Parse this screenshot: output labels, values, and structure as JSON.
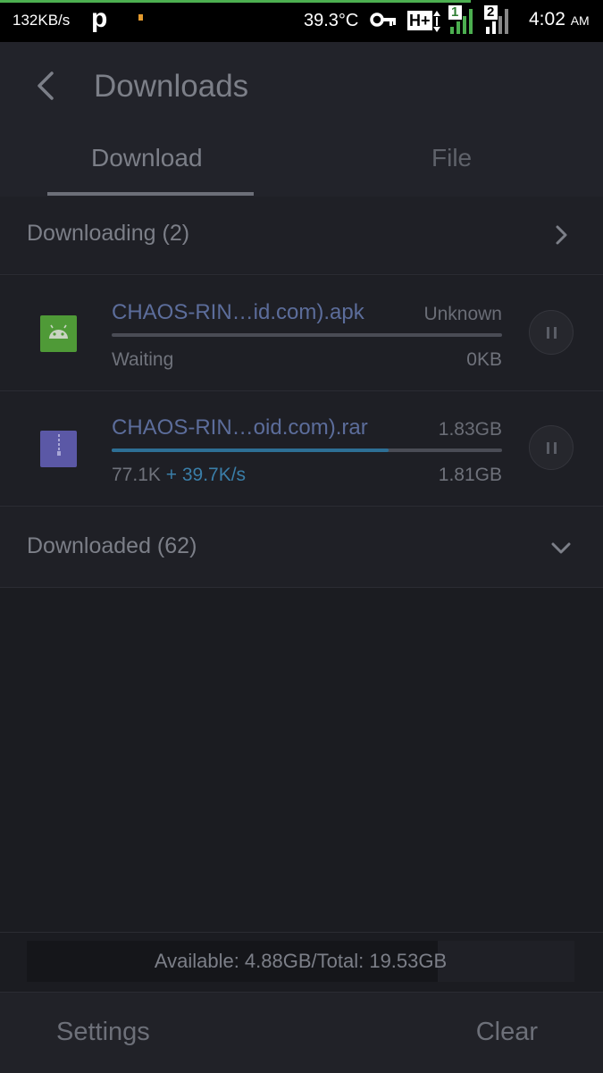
{
  "status_bar": {
    "net_speed": "132KB/s",
    "p_icon": "P",
    "temperature": "39.3°C",
    "network_type": "H+",
    "sim1_label": "1",
    "sim2_label": "2",
    "time": "4:02",
    "ampm": "AM",
    "icons": [
      "key-icon",
      "network-arrows-icon",
      "signal-icon"
    ]
  },
  "header": {
    "title": "Downloads",
    "tabs": [
      {
        "label": "Download",
        "active": true
      },
      {
        "label": "File",
        "active": false
      }
    ]
  },
  "downloading": {
    "label": "Downloading (2)",
    "items": [
      {
        "name": "CHAOS-RIN…id.com).apk",
        "total": "Unknown",
        "status": "Waiting",
        "speed": "",
        "downloaded": "0KB",
        "progress": 0,
        "icon": "android-icon",
        "icon_color": "#4f9a37"
      },
      {
        "name": "CHAOS-RIN…oid.com).rar",
        "total": "1.83GB",
        "status": "77.1K",
        "speed": "+ 39.7K/s",
        "downloaded": "1.81GB",
        "progress": 0.71,
        "icon": "archive-icon",
        "icon_color": "#5b58a6"
      }
    ]
  },
  "downloaded": {
    "label": "Downloaded (62)"
  },
  "storage": {
    "text": "Available: 4.88GB/Total: 19.53GB",
    "used_fraction": 0.75
  },
  "bottom": {
    "settings_label": "Settings",
    "clear_label": "Clear"
  },
  "colors": {
    "accent": "#2d6f95",
    "background": "#1b1c21"
  }
}
